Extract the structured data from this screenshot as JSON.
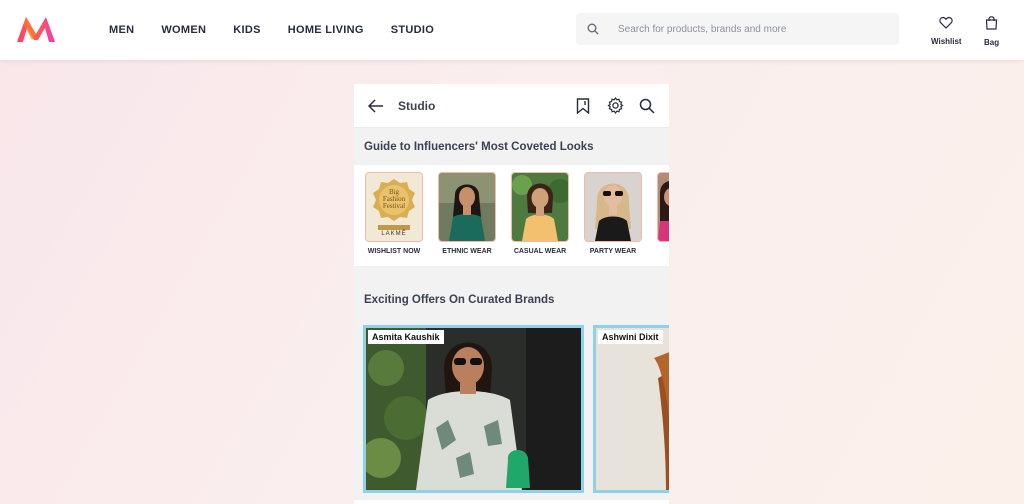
{
  "header": {
    "nav": [
      "MEN",
      "WOMEN",
      "KIDS",
      "HOME LIVING",
      "STUDIO"
    ],
    "search_placeholder": "Search for products, brands and more",
    "wishlist_label": "Wishlist",
    "bag_label": "Bag"
  },
  "studio": {
    "title": "Studio",
    "section1_title": "Guide to Influencers' Most Coveted Looks",
    "categories": [
      {
        "label": "WISHLIST NOW",
        "badge_line1": "Big",
        "badge_line2": "Fashion",
        "badge_line3": "Festival",
        "badge_brand": "LAKMĒ"
      },
      {
        "label": "ETHNIC  WEAR"
      },
      {
        "label": "CASUAL WEAR"
      },
      {
        "label": "PARTY WEAR"
      }
    ],
    "section2_title": "Exciting Offers On Curated Brands",
    "creators": [
      "Asmita Kaushik",
      "Ashwini Dixit"
    ]
  },
  "colors": {
    "accent": "#ff3f6c",
    "card_border": "#8fd1e6",
    "thumb_border": "#f0b9a8"
  }
}
